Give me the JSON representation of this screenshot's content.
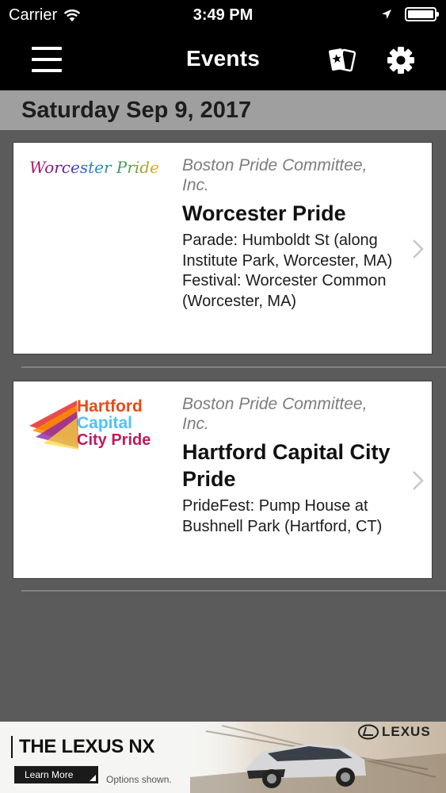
{
  "status_bar": {
    "carrier": "Carrier",
    "time": "3:49 PM"
  },
  "nav": {
    "title": "Events",
    "menu_icon": "hamburger-menu-icon",
    "tickets_icon": "tickets-icon",
    "settings_icon": "gear-icon"
  },
  "date_header": "Saturday Sep 9, 2017",
  "events": [
    {
      "org": "Boston Pride Committee, Inc.",
      "name": "Worcester Pride",
      "location": "Parade: Humboldt St (along Institute Park, Worcester, MA)\nFestival: Worcester Common (Worcester, MA)",
      "logo_text": "Worcester Pride"
    },
    {
      "org": "Boston Pride Committee, Inc.",
      "name": "Hartford Capital City Pride",
      "location": "PrideFest: Pump House at Bushnell Park (Hartford, CT)",
      "logo_lines": [
        "Hartford",
        "Capital",
        "City Pride"
      ]
    }
  ],
  "ad": {
    "headline": "THE LEXUS NX",
    "cta": "Learn More",
    "disclaimer": "Options shown.",
    "brand": "LEXUS"
  },
  "colors": {
    "nav_background": "#000000",
    "date_header_background": "#9f9f9f",
    "list_background": "#5b5b5b",
    "card_background": "#ffffff",
    "org_text": "#7d7d7d"
  }
}
